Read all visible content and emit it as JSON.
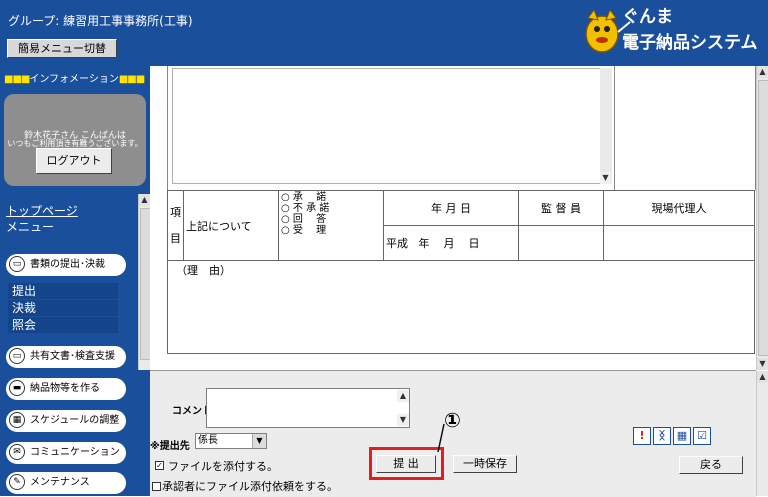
{
  "header": {
    "group_label": "グループ: 練習用工事事務所(工事)",
    "menu_toggle": "簡易メニュー切替",
    "logo_line1": "ぐんま",
    "logo_line2": "電子納品システム"
  },
  "sidebar": {
    "info_heading": "インフォメーション",
    "welcome_line1": "鈴木花子さん こんばんは",
    "welcome_line2": "いつもご利用頂き有難うございます。",
    "logout": "ログアウト",
    "top_page": "トップページ",
    "menu": "メニュー",
    "sections": [
      {
        "label": "書類の提出･決裁",
        "subs": [
          "提出",
          "決裁",
          "照会"
        ]
      },
      {
        "label": "共有文書･検査支援",
        "subs": []
      },
      {
        "label": "納品物等を作る",
        "subs": []
      },
      {
        "label": "スケジュールの調整",
        "subs": []
      },
      {
        "label": "コミュニケーション",
        "subs": []
      },
      {
        "label": "メンテナンス",
        "subs": []
      }
    ]
  },
  "form": {
    "kou": "項",
    "moku": "目",
    "about": "上記について",
    "options": [
      "○ 承　 諾",
      "○ 不 承 諾",
      "○ 回　 答",
      "○ 受　 理"
    ],
    "date_header": "年 月 日",
    "era_row": [
      "平成",
      "年",
      "月",
      "日"
    ],
    "supervisor": "監 督 員",
    "site_agent": "現場代理人",
    "reason": "（理　由）"
  },
  "bottom": {
    "comment_label": "コメント",
    "dest_label": "※提出先",
    "dest_value": "係長",
    "attach_label": "ファイルを添付する。",
    "attach_checked": true,
    "request_label": "承認者にファイル添付依頼をする。",
    "request_checked": false,
    "submit": "提 出",
    "temp_save": "一時保存",
    "back": "戻る",
    "callout": "①"
  },
  "icons": [
    "exclamation-icon",
    "tree-icon",
    "calendar-icon",
    "check-icon"
  ],
  "colors": {
    "nav_blue": "#1a4f9c",
    "highlight_red": "#e02020",
    "accent_yellow": "#ffe400"
  }
}
